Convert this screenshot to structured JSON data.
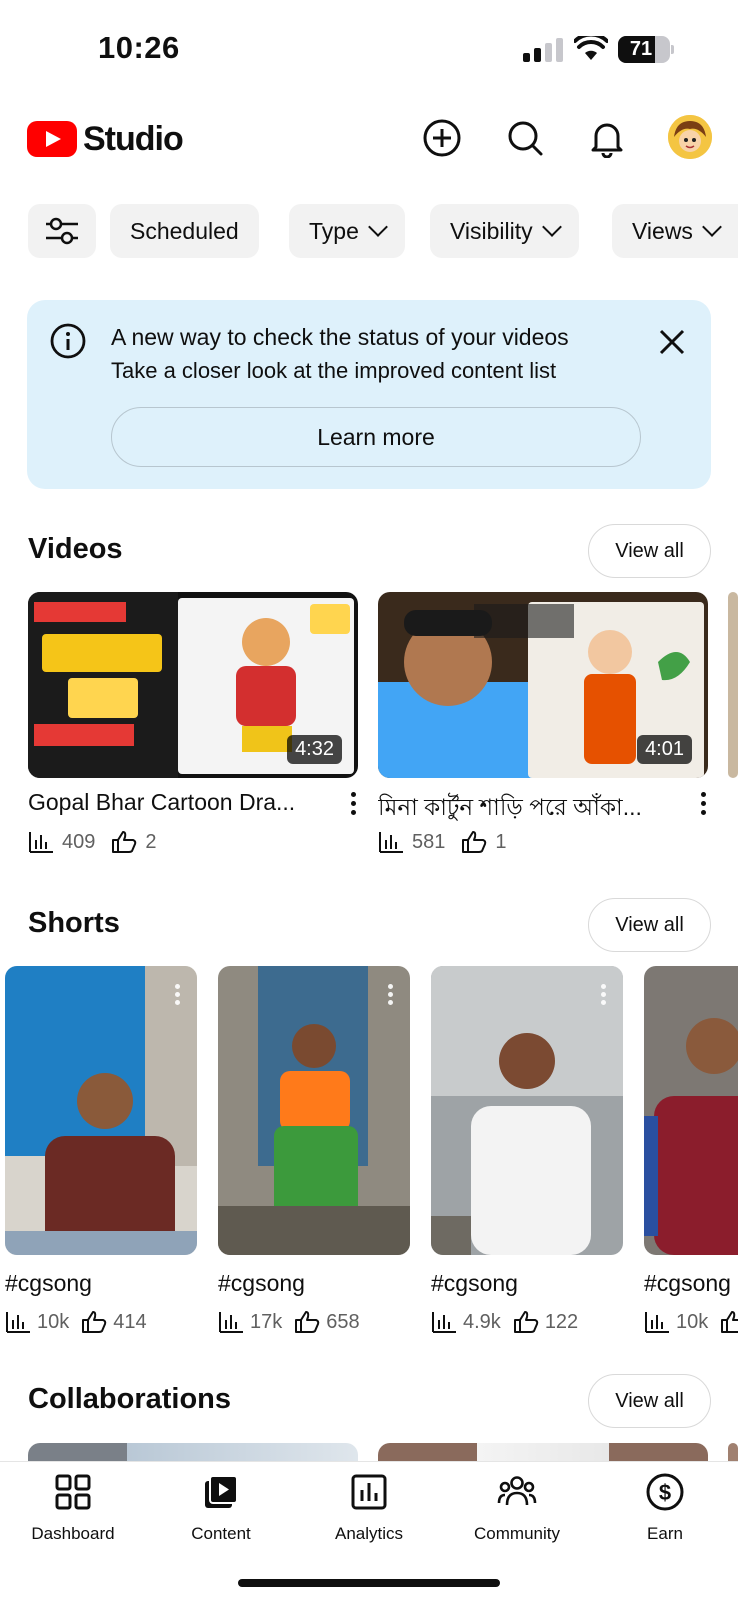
{
  "status_bar": {
    "time": "10:26",
    "battery": "71",
    "battery_level_percent": 71
  },
  "header": {
    "logo_text": "Studio",
    "icons": [
      "create-icon",
      "search-icon",
      "bell-icon",
      "avatar"
    ]
  },
  "filters": {
    "chips": [
      {
        "label": "Scheduled",
        "dropdown": false
      },
      {
        "label": "Type",
        "dropdown": true
      },
      {
        "label": "Visibility",
        "dropdown": true
      },
      {
        "label": "Views",
        "dropdown": true
      }
    ]
  },
  "banner": {
    "title": "A new way to check the status of your videos",
    "subtitle": "Take a closer look at the improved content list",
    "button": "Learn more"
  },
  "videos": {
    "title": "Videos",
    "view_all": "View all",
    "items": [
      {
        "title": "Gopal Bhar Cartoon Dra...",
        "duration": "4:32",
        "views": "409",
        "likes": "2"
      },
      {
        "title": "মিনা কার্টুন শাড়ি পরে আঁকা...",
        "duration": "4:01",
        "views": "581",
        "likes": "1"
      }
    ]
  },
  "shorts": {
    "title": "Shorts",
    "view_all": "View all",
    "items": [
      {
        "title": "#cgsong",
        "views": "10k",
        "likes": "414"
      },
      {
        "title": "#cgsong",
        "views": "17k",
        "likes": "658"
      },
      {
        "title": "#cgsong",
        "views": "4.9k",
        "likes": "122"
      },
      {
        "title": "#cgsong",
        "views": "10k",
        "likes": ""
      }
    ]
  },
  "collaborations": {
    "title": "Collaborations",
    "view_all": "View all"
  },
  "bottom_nav": {
    "items": [
      {
        "label": "Dashboard",
        "icon": "dashboard-icon"
      },
      {
        "label": "Content",
        "icon": "content-icon"
      },
      {
        "label": "Analytics",
        "icon": "analytics-icon"
      },
      {
        "label": "Community",
        "icon": "community-icon"
      },
      {
        "label": "Earn",
        "icon": "earn-icon"
      }
    ]
  },
  "colors": {
    "brand_red": "#ff0000",
    "banner_bg": "#def1fb",
    "chip_bg": "#f2f2f2",
    "muted_text": "#606060"
  }
}
